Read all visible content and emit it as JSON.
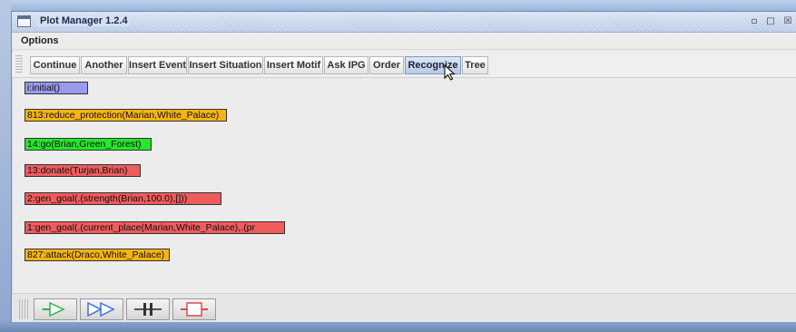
{
  "window": {
    "title": "Plot Manager 1.2.4",
    "controls": [
      "minimize-icon",
      "maximize-icon",
      "close-icon"
    ]
  },
  "menu": {
    "options_label": "Options"
  },
  "toolbar": {
    "buttons": [
      {
        "label": "Continue"
      },
      {
        "label": "Another"
      },
      {
        "label": "Insert Event"
      },
      {
        "label": "Insert Situation"
      },
      {
        "label": "Insert Motif"
      },
      {
        "label": "Ask IPG"
      },
      {
        "label": "Order"
      },
      {
        "label": "Recognize",
        "active": true
      },
      {
        "label": "Tree"
      }
    ]
  },
  "nodes": [
    {
      "label": "i:initial()",
      "color": "#9a9aee"
    },
    {
      "label": "813:reduce_protection(Marian,White_Palace)",
      "color": "#f7b312"
    },
    {
      "label": "14:go(Brian,Green_Forest)",
      "color": "#25e62b"
    },
    {
      "label": "13:donate(Turjan,Brian)",
      "color": "#ee5c5c"
    },
    {
      "label": "2:gen_goal(.(strength(Brian,100.0),[]))",
      "color": "#ee5c5c"
    },
    {
      "label": "1:gen_goal(.(current_place(Marian,White_Palace),.(pr",
      "color": "#ee5c5c"
    },
    {
      "label": "827:attack(Draco,White_Palace)",
      "color": "#f7b312"
    }
  ],
  "playback": {
    "buttons": [
      "play-icon",
      "fast-forward-icon",
      "pause-icon",
      "stop-icon"
    ],
    "accent_green": "#2bb24c",
    "accent_blue": "#3f6fe0",
    "accent_red": "#e04a4a"
  }
}
